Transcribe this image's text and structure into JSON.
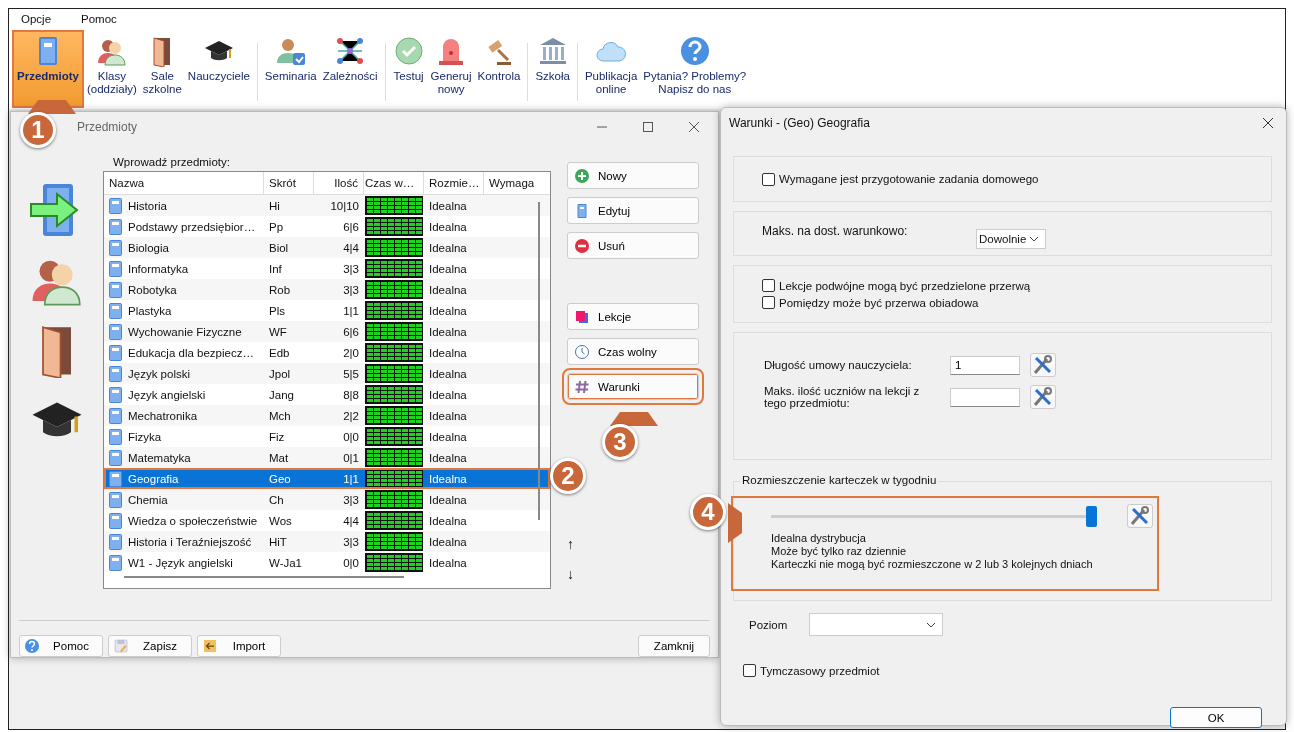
{
  "menu": [
    "Opcje",
    "Pomoc"
  ],
  "toolbar": [
    [
      {
        "kind": "book",
        "lines": [
          "Przedmioty"
        ],
        "selected": true
      },
      {
        "kind": "people",
        "lines": [
          "Klasy",
          "(oddziały)"
        ],
        "selected": false
      },
      {
        "kind": "door",
        "lines": [
          "Sale",
          "szkolne"
        ],
        "selected": false
      },
      {
        "kind": "cap",
        "lines": [
          "Nauczyciele"
        ],
        "selected": false
      }
    ],
    [
      {
        "kind": "personcheck",
        "lines": [
          "Seminaria"
        ],
        "selected": false
      },
      {
        "kind": "network",
        "lines": [
          "Zależności"
        ],
        "selected": false
      }
    ],
    [
      {
        "kind": "check",
        "lines": [
          "Testuj"
        ],
        "selected": false
      },
      {
        "kind": "alarm",
        "lines": [
          "Generuj",
          "nowy"
        ],
        "selected": false
      },
      {
        "kind": "gavel",
        "lines": [
          "Kontrola"
        ],
        "selected": false
      }
    ],
    [
      {
        "kind": "bank",
        "lines": [
          "Szkoła"
        ],
        "selected": false
      }
    ],
    [
      {
        "kind": "cloud",
        "lines": [
          "Publikacja",
          "online"
        ],
        "selected": false
      },
      {
        "kind": "question",
        "lines": [
          "Pytania? Problemy?",
          "Napisz do nas"
        ],
        "selected": false
      }
    ]
  ],
  "subjects_window": {
    "title": "Przedmioty",
    "list_label": "Wprowadź przedmioty:",
    "columns": [
      "Nazwa",
      "Skrót",
      "Ilość",
      "Czas w…",
      "Rozmie…",
      "Wymaga"
    ],
    "rows": [
      {
        "name": "Historia",
        "abbr": "Hi",
        "count": "10|10",
        "placement": "Idealna",
        "selected": false
      },
      {
        "name": "Podstawy przedsiębior…",
        "abbr": "Pp",
        "count": "6|6",
        "placement": "Idealna",
        "selected": false
      },
      {
        "name": "Biologia",
        "abbr": "Biol",
        "count": "4|4",
        "placement": "Idealna",
        "selected": false
      },
      {
        "name": "Informatyka",
        "abbr": "Inf",
        "count": "3|3",
        "placement": "Idealna",
        "selected": false
      },
      {
        "name": "Robotyka",
        "abbr": "Rob",
        "count": "3|3",
        "placement": "Idealna",
        "selected": false
      },
      {
        "name": "Plastyka",
        "abbr": "Pls",
        "count": "1|1",
        "placement": "Idealna",
        "selected": false
      },
      {
        "name": "Wychowanie Fizyczne",
        "abbr": "WF",
        "count": "6|6",
        "placement": "Idealna",
        "selected": false
      },
      {
        "name": "Edukacja dla bezpiecz…",
        "abbr": "Edb",
        "count": "2|0",
        "placement": "Idealna",
        "selected": false
      },
      {
        "name": "Język polski",
        "abbr": "Jpol",
        "count": "5|5",
        "placement": "Idealna",
        "selected": false
      },
      {
        "name": "Język angielski",
        "abbr": "Jang",
        "count": "8|8",
        "placement": "Idealna",
        "selected": false
      },
      {
        "name": "Mechatronika",
        "abbr": "Mch",
        "count": "2|2",
        "placement": "Idealna",
        "selected": false
      },
      {
        "name": "Fizyka",
        "abbr": "Fiz",
        "count": "0|0",
        "placement": "Idealna",
        "selected": false
      },
      {
        "name": "Matematyka",
        "abbr": "Mat",
        "count": "0|1",
        "placement": "Idealna",
        "selected": false
      },
      {
        "name": "Geografia",
        "abbr": "Geo",
        "count": "1|1",
        "placement": "Idealna",
        "selected": true
      },
      {
        "name": "Chemia",
        "abbr": "Ch",
        "count": "3|3",
        "placement": "Idealna",
        "selected": false
      },
      {
        "name": "Wiedza o społeczeństwie",
        "abbr": "Wos",
        "count": "4|4",
        "placement": "Idealna",
        "selected": false
      },
      {
        "name": "Historia i Teraźniejszość",
        "abbr": "HiT",
        "count": "3|3",
        "placement": "Idealna",
        "selected": false
      },
      {
        "name": "W1 - Język angielski",
        "abbr": "W-Ja1",
        "count": "0|0",
        "placement": "Idealna",
        "selected": false
      }
    ],
    "actions": [
      {
        "label": "Nowy",
        "kind": "plus",
        "highlighted": false,
        "gap_before": false
      },
      {
        "label": "Edytuj",
        "kind": "book",
        "highlighted": false,
        "gap_before": false
      },
      {
        "label": "Usuń",
        "kind": "minus",
        "highlighted": false,
        "gap_before": false
      },
      {
        "label": "Lekcje",
        "kind": "cards",
        "highlighted": false,
        "gap_before": true
      },
      {
        "label": "Czas wolny",
        "kind": "clock",
        "highlighted": false,
        "gap_before": false
      },
      {
        "label": "Warunki",
        "kind": "hash",
        "highlighted": true,
        "gap_before": false
      }
    ],
    "move_up": "↑",
    "move_down": "↓",
    "footer": [
      {
        "label": "Pomoc",
        "kind": "question"
      },
      {
        "label": "Zapisz",
        "kind": "save"
      },
      {
        "label": "Import",
        "kind": "import"
      }
    ],
    "close_button": "Zamknij"
  },
  "conditions_window": {
    "title": "Warunki - (Geo) Geografia",
    "homework": {
      "label": "Wymagane jest przygotowanie zadania domowego",
      "checked": false
    },
    "max_conditional": {
      "label": "Maks. na dost. warunkowo:",
      "value": "Dowolnie"
    },
    "double_lessons": [
      {
        "label": "Lekcje podwójne mogą być przedzielone przerwą",
        "checked": false
      },
      {
        "label": "Pomiędzy może być przerwa obiadowa",
        "checked": false
      }
    ],
    "teacher_contract": {
      "label": "Długość umowy nauczyciela:",
      "value": "1"
    },
    "max_students": {
      "label": "Maks. ilość uczniów na lekcji z tego przedmiotu:"
    },
    "distribution": {
      "legend": "Rozmieszczenie karteczek w tygodniu",
      "level": 1,
      "highlighted": true,
      "lines": [
        "Idealna dystrybucja",
        "Może być tylko raz dziennie",
        "Karteczki nie mogą być rozmieszczone w 2 lub 3 kolejnych dniach"
      ]
    },
    "level_label": "Poziom",
    "temporary": {
      "label": "Tymczasowy przedmiot",
      "checked": false
    },
    "ok": "OK"
  },
  "callouts": [
    "1",
    "2",
    "3",
    "4"
  ]
}
